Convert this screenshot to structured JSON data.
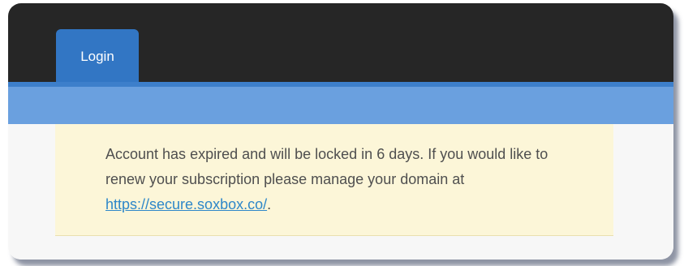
{
  "tabs": [
    {
      "label": "Login",
      "active": true
    }
  ],
  "alert": {
    "message_before_link": "Account has expired and will be locked in 6 days. If you would like to renew your subscription please manage your domain at ",
    "link_text": "https://secure.soxbox.co/",
    "message_after_link": "."
  },
  "colors": {
    "header_background": "#262626",
    "tab_active": "#3276c4",
    "bar": "#6aa0df",
    "alert_background": "#fcf6d8",
    "link": "#2e87c9"
  }
}
